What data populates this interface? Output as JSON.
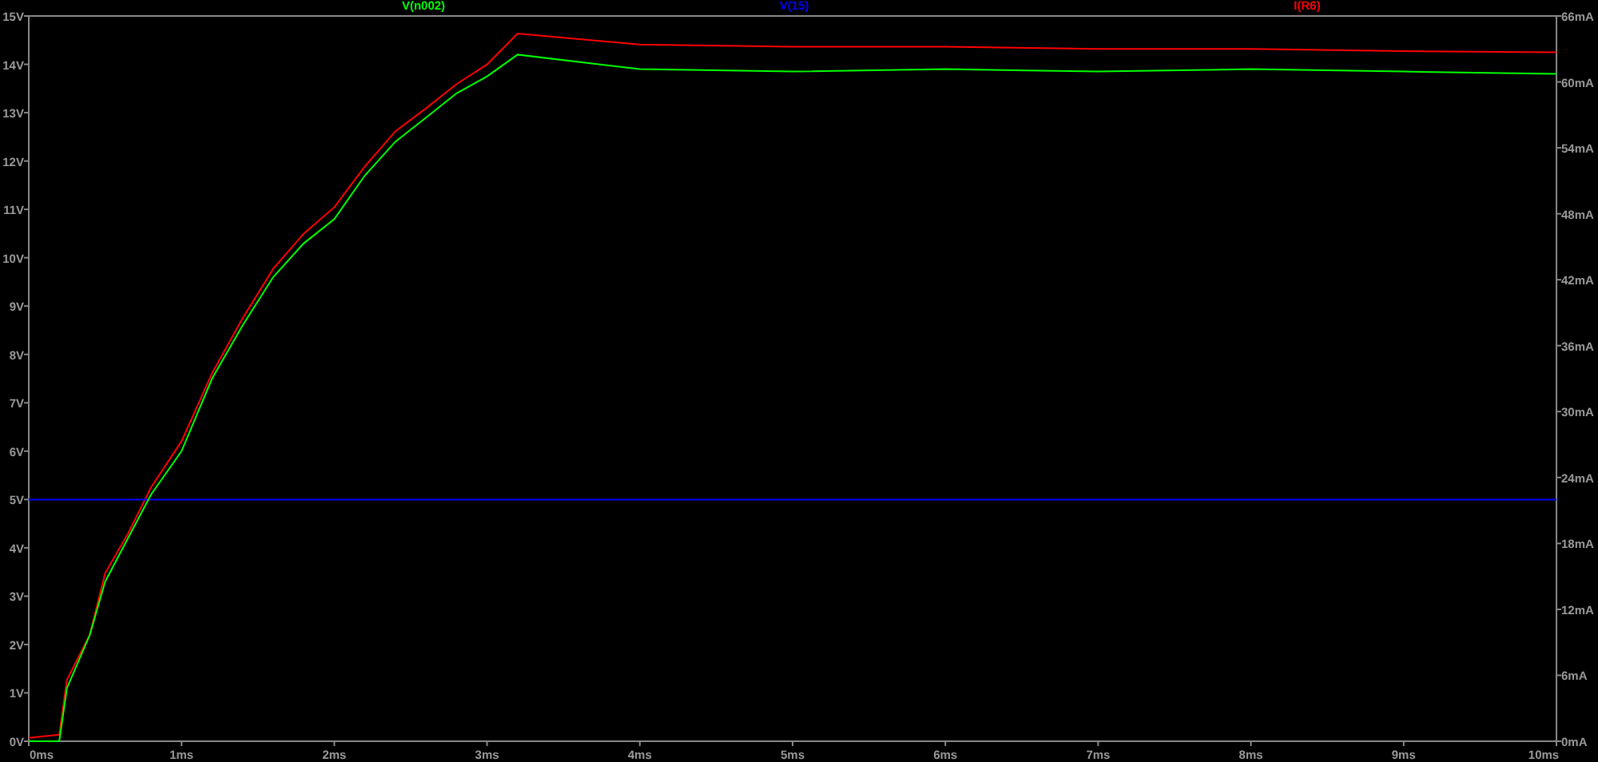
{
  "chart_data": {
    "type": "line",
    "x": [
      0,
      0.2,
      0.25,
      0.4,
      0.5,
      0.65,
      0.8,
      1.0,
      1.2,
      1.4,
      1.6,
      1.8,
      2.0,
      2.2,
      2.4,
      2.6,
      2.8,
      3.0,
      3.2,
      4,
      5,
      6,
      7,
      8,
      9,
      10
    ],
    "series": [
      {
        "name": "V(n002)",
        "color": "#00ff00",
        "values": [
          0,
          0,
          1.1,
          2.2,
          3.3,
          4.2,
          5.1,
          6.0,
          7.5,
          8.6,
          9.6,
          10.3,
          10.8,
          11.7,
          12.4,
          12.9,
          13.4,
          13.75,
          14.2,
          13.9,
          13.85,
          13.9,
          13.85,
          13.9,
          13.85,
          13.8
        ]
      },
      {
        "name": "V(15)",
        "color": "#0000ff",
        "values": [
          5,
          5,
          5,
          5,
          5,
          5,
          5,
          5,
          5,
          5,
          5,
          5,
          5,
          5,
          5,
          5,
          5,
          5,
          5,
          5,
          5,
          5,
          5,
          5,
          5,
          5
        ]
      },
      {
        "name": "I(R6)",
        "color": "#ff0000",
        "axis": "y2",
        "values": [
          0.3,
          0.6,
          5.6,
          9.7,
          15.3,
          18.9,
          23.1,
          27.3,
          33.5,
          38.5,
          43,
          46.2,
          48.6,
          52.3,
          55.5,
          57.6,
          59.8,
          61.6,
          64.4,
          63.4,
          63.2,
          63.2,
          63.0,
          63.0,
          62.8,
          62.7
        ]
      }
    ],
    "xlim": [
      0,
      10
    ],
    "ylim": [
      0,
      15
    ],
    "xticks": [
      {
        "value": 0,
        "label": "0ms"
      },
      {
        "value": 1,
        "label": "1ms"
      },
      {
        "value": 2,
        "label": "2ms"
      },
      {
        "value": 3,
        "label": "3ms"
      },
      {
        "value": 4,
        "label": "4ms"
      },
      {
        "value": 5,
        "label": "5ms"
      },
      {
        "value": 6,
        "label": "6ms"
      },
      {
        "value": 7,
        "label": "7ms"
      },
      {
        "value": 8,
        "label": "8ms"
      },
      {
        "value": 9,
        "label": "9ms"
      },
      {
        "value": 10,
        "label": "10ms"
      }
    ],
    "yticks": [
      {
        "value": 0,
        "label": "0V"
      },
      {
        "value": 1,
        "label": "1V"
      },
      {
        "value": 2,
        "label": "2V"
      },
      {
        "value": 3,
        "label": "3V"
      },
      {
        "value": 4,
        "label": "4V"
      },
      {
        "value": 5,
        "label": "5V"
      },
      {
        "value": 6,
        "label": "6V"
      },
      {
        "value": 7,
        "label": "7V"
      },
      {
        "value": 8,
        "label": "8V"
      },
      {
        "value": 9,
        "label": "9V"
      },
      {
        "value": 10,
        "label": "10V"
      },
      {
        "value": 11,
        "label": "11V"
      },
      {
        "value": 12,
        "label": "12V"
      },
      {
        "value": 13,
        "label": "13V"
      },
      {
        "value": 14,
        "label": "14V"
      },
      {
        "value": 15,
        "label": "15V"
      }
    ],
    "y2lim": [
      0,
      66
    ],
    "y2ticks": [
      {
        "value": 0,
        "label": "0mA"
      },
      {
        "value": 6,
        "label": "6mA"
      },
      {
        "value": 12,
        "label": "12mA"
      },
      {
        "value": 18,
        "label": "18mA"
      },
      {
        "value": 24,
        "label": "24mA"
      },
      {
        "value": 30,
        "label": "30mA"
      },
      {
        "value": 36,
        "label": "36mA"
      },
      {
        "value": 42,
        "label": "42mA"
      },
      {
        "value": 48,
        "label": "48mA"
      },
      {
        "value": 54,
        "label": "54mA"
      },
      {
        "value": 60,
        "label": "60mA"
      },
      {
        "value": 66,
        "label": "66mA"
      }
    ]
  }
}
